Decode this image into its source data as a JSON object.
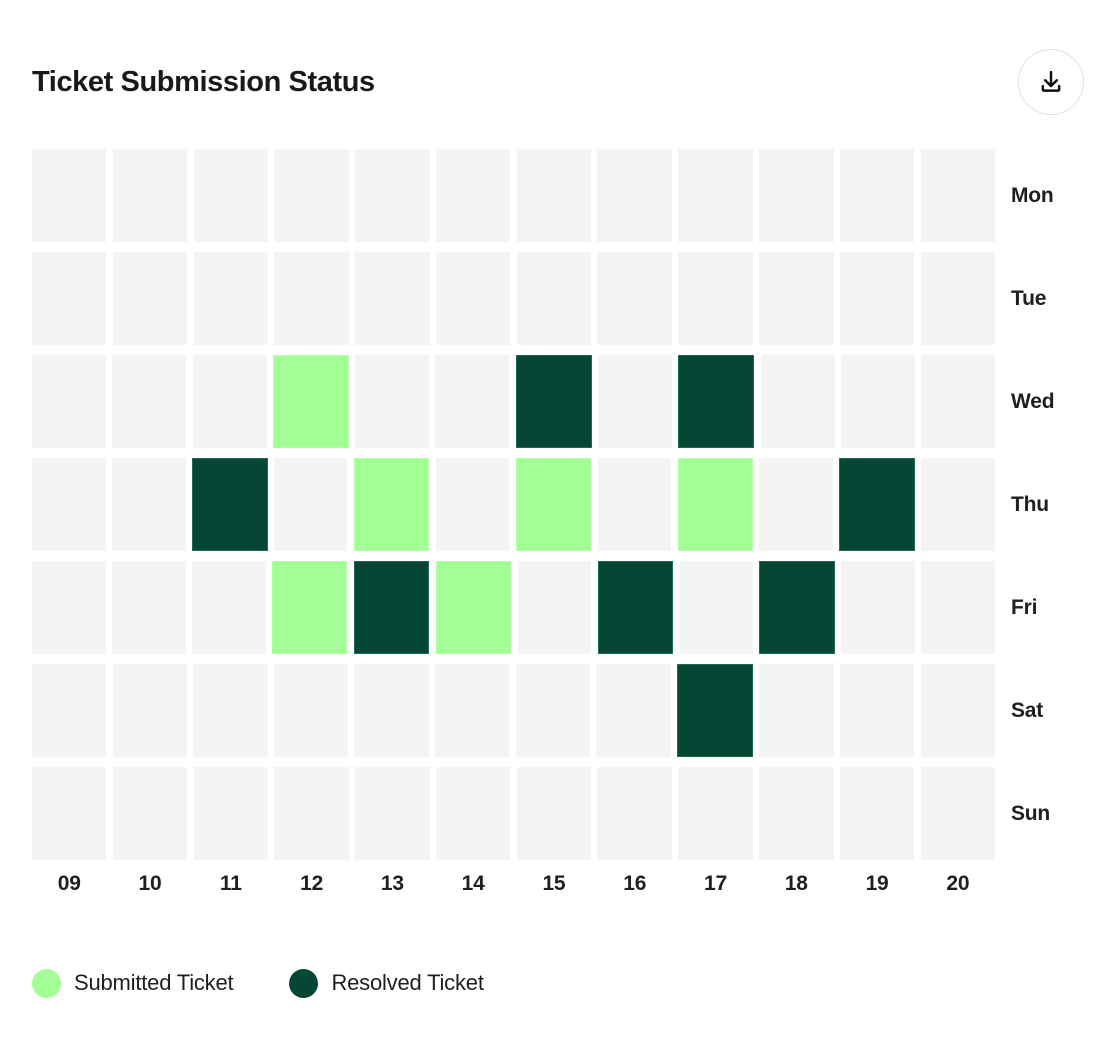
{
  "header": {
    "title": "Ticket Submission Status",
    "download_icon": "download-icon"
  },
  "colors": {
    "submitted": "#a3fe96",
    "resolved": "#064635",
    "empty": "#f4f5f3",
    "background": "#ffffff",
    "text": "#1d1f22"
  },
  "legend": {
    "items": [
      {
        "label": "Submitted Ticket",
        "color": "#a3fe96",
        "key": "submitted"
      },
      {
        "label": "Resolved Ticket",
        "color": "#064635",
        "key": "resolved"
      }
    ]
  },
  "chart_data": {
    "type": "heatmap",
    "title": "Ticket Submission Status",
    "xlabel": "",
    "ylabel": "",
    "grid": false,
    "legend_position": "bottom-left",
    "categories": [
      "09",
      "10",
      "11",
      "12",
      "13",
      "14",
      "15",
      "16",
      "17",
      "18",
      "19",
      "20"
    ],
    "rows": [
      "Mon",
      "Tue",
      "Wed",
      "Thu",
      "Fri",
      "Sat",
      "Sun"
    ],
    "value_legend": {
      "0": "none",
      "1": "submitted",
      "2": "resolved"
    },
    "values": [
      [
        0,
        0,
        0,
        0,
        0,
        0,
        0,
        0,
        0,
        0,
        0,
        0
      ],
      [
        0,
        0,
        0,
        0,
        0,
        0,
        0,
        0,
        0,
        0,
        0,
        0
      ],
      [
        0,
        0,
        0,
        1,
        0,
        0,
        2,
        0,
        2,
        0,
        0,
        0
      ],
      [
        0,
        0,
        2,
        0,
        1,
        0,
        1,
        0,
        1,
        0,
        2,
        0
      ],
      [
        0,
        0,
        0,
        1,
        2,
        1,
        0,
        2,
        0,
        2,
        0,
        0
      ],
      [
        0,
        0,
        0,
        0,
        0,
        0,
        0,
        0,
        2,
        0,
        0,
        0
      ],
      [
        0,
        0,
        0,
        0,
        0,
        0,
        0,
        0,
        0,
        0,
        0,
        0
      ]
    ],
    "marked_cells": [
      {
        "day": "Wed",
        "date": "12",
        "status": "submitted"
      },
      {
        "day": "Wed",
        "date": "15",
        "status": "resolved"
      },
      {
        "day": "Wed",
        "date": "17",
        "status": "resolved"
      },
      {
        "day": "Thu",
        "date": "11",
        "status": "resolved"
      },
      {
        "day": "Thu",
        "date": "13",
        "status": "submitted"
      },
      {
        "day": "Thu",
        "date": "15",
        "status": "submitted"
      },
      {
        "day": "Thu",
        "date": "17",
        "status": "submitted"
      },
      {
        "day": "Thu",
        "date": "19",
        "status": "resolved"
      },
      {
        "day": "Fri",
        "date": "12",
        "status": "submitted"
      },
      {
        "day": "Fri",
        "date": "13",
        "status": "resolved"
      },
      {
        "day": "Fri",
        "date": "14",
        "status": "submitted"
      },
      {
        "day": "Fri",
        "date": "16",
        "status": "resolved"
      },
      {
        "day": "Fri",
        "date": "18",
        "status": "resolved"
      },
      {
        "day": "Sat",
        "date": "17",
        "status": "resolved"
      }
    ]
  }
}
